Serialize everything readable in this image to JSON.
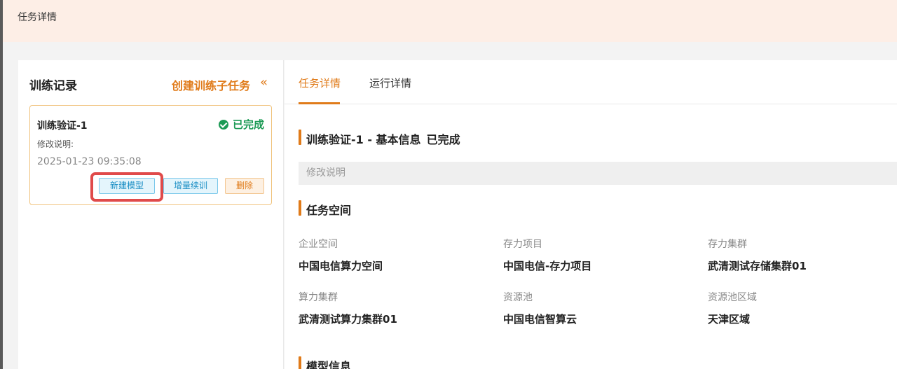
{
  "header": {
    "title": "任务详情"
  },
  "left_panel": {
    "title": "训练记录",
    "create_link": "创建训练子任务",
    "collapse_icon": "«",
    "card": {
      "name": "训练验证-1",
      "status": "已完成",
      "status_color": "#1c9a55",
      "desc_label": "修改说明:",
      "time": "2025-01-23 09:35:08",
      "buttons": {
        "new_model": "新建模型",
        "incremental": "增量续训",
        "delete": "删除"
      }
    }
  },
  "tabs": [
    {
      "label": "任务详情",
      "active": true
    },
    {
      "label": "运行详情",
      "active": false
    }
  ],
  "basic_info": {
    "title": "训练验证-1 - 基本信息",
    "status": "已完成",
    "desc_placeholder": "修改说明"
  },
  "task_space": {
    "title": "任务空间",
    "fields": [
      {
        "label": "企业空间",
        "value": "中国电信算力空间"
      },
      {
        "label": "存力项目",
        "value": "中国电信-存力项目"
      },
      {
        "label": "存力集群",
        "value": "武清测试存储集群01"
      },
      {
        "label": "算力集群",
        "value": "武清测试算力集群01"
      },
      {
        "label": "资源池",
        "value": "中国电信智算云"
      },
      {
        "label": "资源池区域",
        "value": "天津区域"
      }
    ]
  },
  "model_info": {
    "title": "模型信息"
  },
  "colors": {
    "accent": "#e07b1a",
    "highlight": "#e04a4a",
    "topbar": "#fdeee6"
  }
}
